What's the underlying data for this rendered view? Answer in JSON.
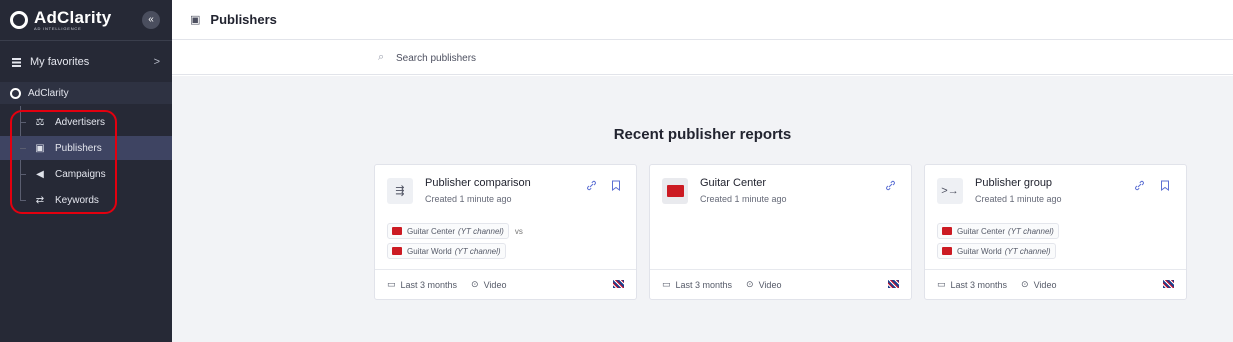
{
  "sidebar": {
    "logo_name": "AdClarity",
    "logo_subtitle": "AD INTELLIGENCE",
    "collapse_icon": "«",
    "favorites_label": "My favorites",
    "favorites_chevron": ">",
    "section_label": "AdClarity",
    "items": [
      {
        "label": "Advertisers",
        "icon": "advertisers-icon",
        "glyph": "⚖"
      },
      {
        "label": "Publishers",
        "icon": "monitor-icon",
        "glyph": "▣"
      },
      {
        "label": "Campaigns",
        "icon": "megaphone-icon",
        "glyph": "◀"
      },
      {
        "label": "Keywords",
        "icon": "keywords-icon",
        "glyph": "⇄"
      }
    ],
    "active_index": 1
  },
  "header": {
    "title": "Publishers",
    "icon_glyph": "▣"
  },
  "search": {
    "placeholder": "Search publishers",
    "icon_glyph": "⌕"
  },
  "main": {
    "section_title": "Recent publisher reports",
    "cards": [
      {
        "title": "Publisher comparison",
        "subtitle": "Created 1 minute ago",
        "icon_glyph": "⇶",
        "tags": [
          {
            "name": "Guitar Center",
            "type": "(YT channel)"
          },
          {
            "name": "Guitar World",
            "type": "(YT channel)"
          }
        ],
        "vs_label": "vs",
        "period": "Last 3 months",
        "media": "Video"
      },
      {
        "title": "Guitar Center",
        "subtitle": "Created 1 minute ago",
        "period": "Last 3 months",
        "media": "Video"
      },
      {
        "title": "Publisher group",
        "subtitle": "Created 1 minute ago",
        "icon_glyph": ">→",
        "tags": [
          {
            "name": "Guitar Center",
            "type": "(YT channel)"
          },
          {
            "name": "Guitar World",
            "type": "(YT channel)"
          }
        ],
        "period": "Last 3 months",
        "media": "Video"
      }
    ]
  },
  "colors": {
    "sidebar_bg": "#262936",
    "active_bg": "#3e4462",
    "highlight": "#e3000f",
    "accent": "#5b6fd3"
  }
}
